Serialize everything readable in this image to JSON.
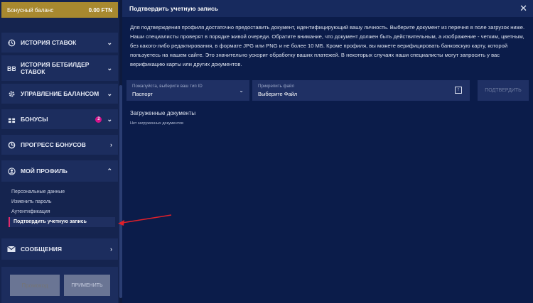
{
  "sidebar": {
    "balance": {
      "label": "Бонусный баланс",
      "value": "0.00 FTN"
    },
    "items": [
      {
        "label": "ИСТОРИЯ СТАВОК",
        "icon": "history-icon",
        "chevron": "⌄"
      },
      {
        "label": "ИСТОРИЯ БЕТБИЛДЕР СТАВОК",
        "icon": "betbuilder-icon",
        "chevron": "⌄"
      },
      {
        "label": "УПРАВЛЕНИЕ БАЛАНСОМ",
        "icon": "gear-icon",
        "chevron": "⌄"
      },
      {
        "label": "БОНУСЫ",
        "icon": "gift-icon",
        "chevron": "⌄",
        "badge": "2"
      },
      {
        "label": "ПРОГРЕСС БОНУСОВ",
        "icon": "progress-icon",
        "chevron": "›"
      },
      {
        "label": "МОЙ ПРОФИЛЬ",
        "icon": "user-icon",
        "chevron": "⌃"
      },
      {
        "label": "СООБЩЕНИЯ",
        "icon": "envelope-icon",
        "chevron": "›"
      }
    ],
    "profile_submenu": [
      "Персональные данные",
      "Изменить пароль",
      "Аутентификация",
      "Подтвердить учетную запись"
    ],
    "promo": {
      "placeholder": "Промокод",
      "apply_label": "ПРИМЕНИТЬ"
    }
  },
  "main": {
    "title": "Подтвердить учетную запись",
    "description": "Для подтверждения профиля достаточно предоставить документ, идентифицирующий вашу личность. Выберите документ из перечня в поле загрузок ниже. Наши специалисты проверят в порядке живой очереди. Обратите внимание, что документ должен быть действительным, а изображение - четким, цветным, без какого-либо редактирования, в формате JPG или PNG и не более 10 МБ. Кроме профиля, вы можете верифицировать банковскую карту, которой пользуетесь на нашем сайте. Это значительно ускорит обработку ваших платежей. В некоторых случаях наши специалисты могут запросить у вас верификацию карты или других документов.",
    "doc_type": {
      "placeholder": "Пожалуйста, выберите ваш тип ID",
      "value": "Паспорт"
    },
    "file": {
      "placeholder": "Прикрепить файл",
      "value": "Выберите Файл"
    },
    "confirm_label": "ПОДТВЕРДИТЬ",
    "uploaded_title": "Загруженные документы",
    "uploaded_empty": "Нет загруженных документов"
  },
  "colors": {
    "accent_gold": "#a8892f",
    "badge_pink": "#d6148a",
    "annotation_red": "#e0202a"
  }
}
